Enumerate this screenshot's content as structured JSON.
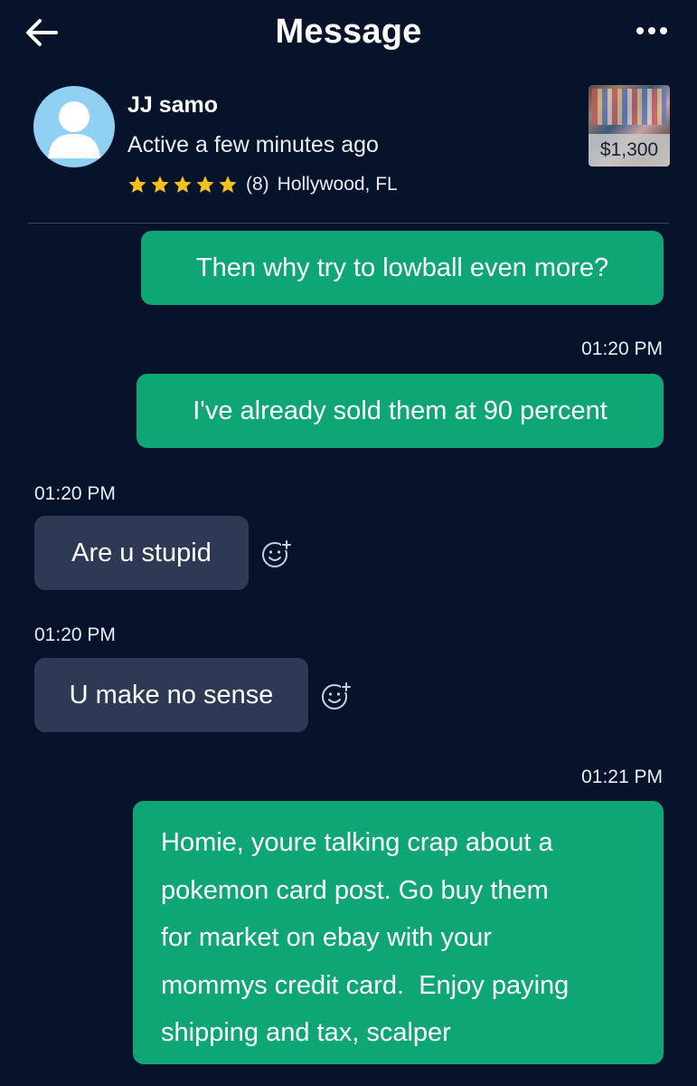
{
  "header": {
    "title": "Message",
    "back_icon": "arrow-left-icon",
    "more_icon": "more-horizontal-icon"
  },
  "contact": {
    "name": "JJ samo",
    "status": "Active a few minutes ago",
    "rating": 5,
    "reviews": "(8)",
    "location": "Hollywood, FL",
    "avatar_icon": "user-avatar-icon"
  },
  "listing": {
    "price": "$1,300"
  },
  "colors": {
    "background": "#07132b",
    "outgoing": "#0fa676",
    "incoming": "#2e3a55",
    "star": "#f6c11b"
  },
  "messages": [
    {
      "direction": "out",
      "text": "Then why try to lowball even more?",
      "time": ""
    },
    {
      "direction": "out",
      "text": "I've already sold them at 90 percent",
      "time": "01:20 PM"
    },
    {
      "direction": "in",
      "text": "Are u stupid",
      "time": "01:20 PM"
    },
    {
      "direction": "in",
      "text": "U make no sense",
      "time": "01:20 PM"
    },
    {
      "direction": "out",
      "lines": [
        "Homie, youre talking crap about a",
        "pokemon card post. Go buy them",
        "for market on ebay with your",
        "mommys credit card.  Enjoy paying",
        "shipping and tax, scalper"
      ],
      "time": "01:21 PM"
    }
  ]
}
